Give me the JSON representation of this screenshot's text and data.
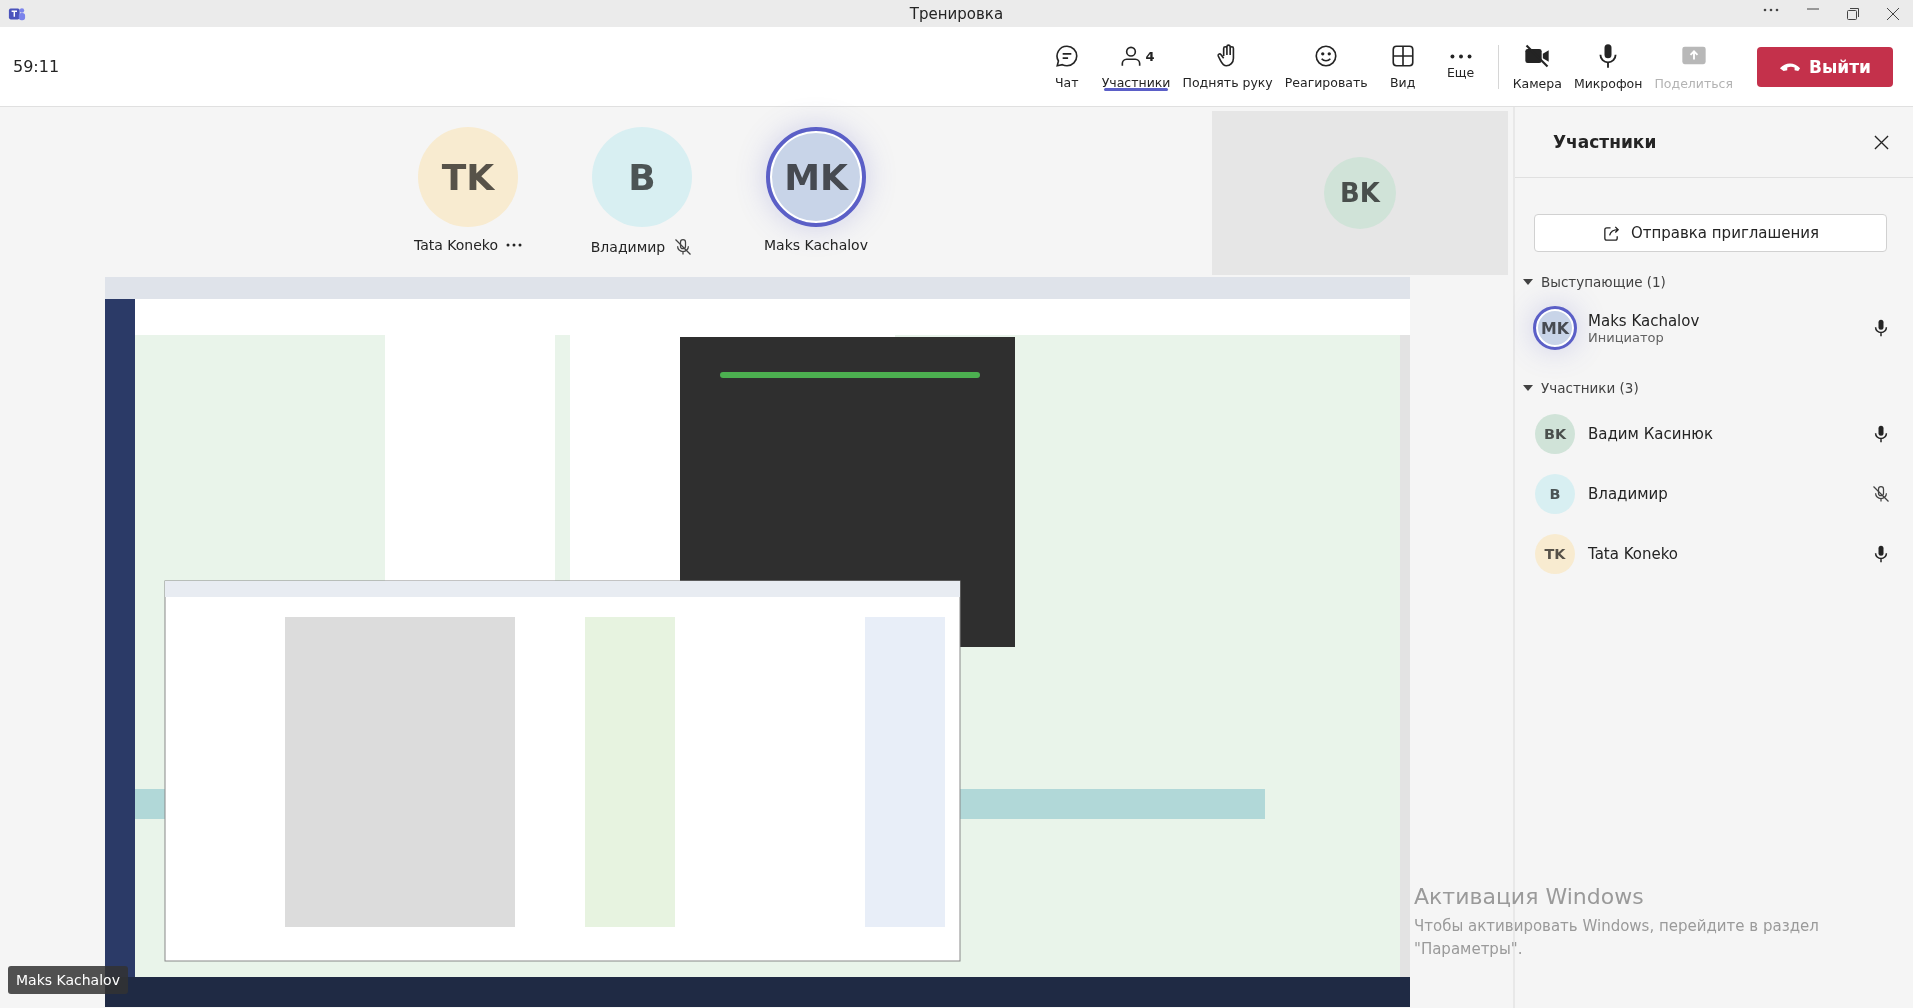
{
  "window": {
    "title": "Тренировка"
  },
  "toolbar": {
    "timer": "59:11",
    "buttons": [
      {
        "kind": "chat",
        "label": "Чат",
        "selected": false,
        "disabled": false
      },
      {
        "kind": "people",
        "label": "Участники",
        "badge": "4",
        "selected": true,
        "disabled": false
      },
      {
        "kind": "hand",
        "label": "Поднять руку",
        "selected": false,
        "disabled": false
      },
      {
        "kind": "react",
        "label": "Реагировать",
        "selected": false,
        "disabled": false
      },
      {
        "kind": "view",
        "label": "Вид",
        "selected": false,
        "disabled": false
      },
      {
        "kind": "more",
        "label": "Еще",
        "selected": false,
        "disabled": false
      }
    ],
    "devices": [
      {
        "kind": "camera",
        "label": "Камера",
        "on": false,
        "disabled": false
      },
      {
        "kind": "mic",
        "label": "Микрофон",
        "on": true,
        "disabled": false
      },
      {
        "kind": "share",
        "label": "Поделиться",
        "disabled": true
      }
    ],
    "leave": "Выйти"
  },
  "stage": {
    "tiles": [
      {
        "initials": "TK",
        "name": "Tata Koneko",
        "color": "#f8ebd0",
        "speaking": false,
        "muted": false,
        "menu": true
      },
      {
        "initials": "B",
        "name": "Владимир",
        "color": "#d8eff2",
        "speaking": false,
        "muted": true,
        "menu": false
      },
      {
        "initials": "MK",
        "name": "Maks Kachalov",
        "color": "#c8d4e8",
        "speaking": true,
        "muted": false,
        "menu": false
      }
    ],
    "remote": {
      "initials": "BK",
      "color": "#d0e3d8"
    },
    "share": {
      "kind": "picture",
      "presenter": "Maks Kachalov"
    },
    "activation": {
      "title": "Активация Windows",
      "text": "Чтобы активировать Windows, перейдите в раздел \"Параметры\"."
    }
  },
  "panel": {
    "title": "Участники",
    "invite": "Отправка приглашения",
    "groups": [
      {
        "title": "Выступающие (1)",
        "expanded": true,
        "people": [
          {
            "initials": "MK",
            "name": "Maks Kachalov",
            "role": "Инициатор",
            "color": "#c8d4e8",
            "speaking": true,
            "muted": false
          }
        ]
      },
      {
        "title": "Участники (3)",
        "expanded": true,
        "people": [
          {
            "initials": "BK",
            "name": "Вадим Касинюк",
            "color": "#d0e3d8",
            "speaking": false,
            "muted": false
          },
          {
            "initials": "B",
            "name": "Владимир",
            "color": "#d8eff2",
            "speaking": false,
            "muted": true
          },
          {
            "initials": "TK",
            "name": "Tata Koneko",
            "color": "#f8ebd0",
            "speaking": false,
            "muted": false
          }
        ]
      }
    ]
  }
}
